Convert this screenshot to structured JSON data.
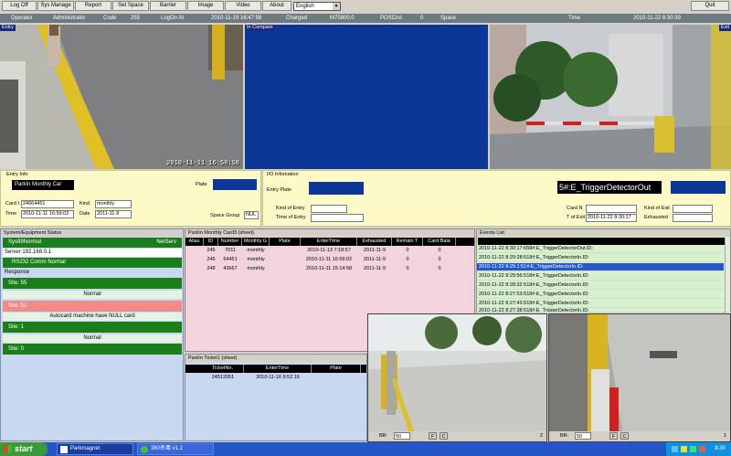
{
  "toolbar": {
    "buttons": [
      "Log Off",
      "Sys Manage",
      "Report",
      "Set Space",
      "Barrier",
      "Image",
      "Video",
      "About"
    ],
    "language": "English",
    "quit": "Quit"
  },
  "status": {
    "operator_label": "Operator",
    "operator_value": "Administrator",
    "code_label": "Code",
    "code_value": "255",
    "logon_label": "LogOn At",
    "logon_value": "2010-11-19 16:47:58",
    "charged_label": "Charged",
    "charged_value": "M70800.0",
    "poscnt_label": "POSCnd",
    "poscnt_value": "0",
    "space_label": "Space",
    "time_label": "Time",
    "time_value": "2010-11-22 8:30:39"
  },
  "cameras": {
    "entry_label": "Entry",
    "entry_timestamp": "2010-11-11 16:58:58",
    "compare_label": "In Compare",
    "exit_label": "Exit",
    "exit_plate": "5#:E_TriggerDetectorOut"
  },
  "entry_info": {
    "title": "Entry Info",
    "card_type": "ParkIn Monthly Car",
    "plate_label": "Plate",
    "card_label": "Card I",
    "card_value": "24664451",
    "kind_label": "Kind",
    "kind_value": "monthly",
    "time_label": "Time",
    "time_value": "2010-11-11 16:59:02",
    "date_label": "Date",
    "date_value": "2011-11-9",
    "space_group_label": "Space Group",
    "space_group_value": "NUL"
  },
  "io_info": {
    "title": "I/O Infomation",
    "entry_plate_label": "Entry Plate",
    "kind_of_entry_label": "Kind of Entry",
    "time_of_entry_label": "Time of Entry",
    "card_no_label": "Card N",
    "time_of_exit_label": "T of Exit",
    "time_of_exit_value": "2010-11-22 8:30:17",
    "kind_of_exit_label": "Kind of Exit",
    "exhausted_label": "Exhausted"
  },
  "system": {
    "title": "System/Equipment Status",
    "sys_label": "Sys99Normal",
    "netserv": "NetServ",
    "server": "Server:192.168.0.1",
    "rs232": "RS232 Comm Normal",
    "response": "Response",
    "site55": "Site:  55",
    "normal1": "Normal",
    "site51": "Site:  51",
    "autocard": "Autocard machine have NULL card",
    "site1": "Site:  1",
    "normal2": "Normal",
    "site0": "Site:  0"
  },
  "monthly": {
    "title": "ParkIn Monthly Card3 (sheet)",
    "columns": [
      "Alias",
      "ID",
      "Number",
      "Monthly G",
      "Plate",
      "EnterTime",
      "Exhausted",
      "Remain T",
      "Card Bala"
    ],
    "rows": [
      [
        "245",
        "7011",
        "monthly",
        "",
        "2010-11-13 7:18:57",
        "2011-11-9",
        "0",
        "0"
      ],
      [
        "246",
        "64451",
        "monthly",
        "",
        "2010-11-11 16:59:02",
        "2011-11-9",
        "0",
        "0"
      ],
      [
        "248",
        "43667",
        "monthly",
        "",
        "2010-11-11 15:14:58",
        "2011-11-9",
        "0",
        "0"
      ]
    ]
  },
  "ticket": {
    "title": "ParkIn Ticket1 (sheet)",
    "columns": [
      "TicketNo.",
      "EnterTime",
      "Plate"
    ],
    "rows": [
      [
        "24512051",
        "2010-11-16 9:52:16",
        ""
      ]
    ]
  },
  "events": {
    "title": "Events List",
    "items": [
      "2010-11-22 8:30:17:658#:E_TriggerDetectorOut.ID:",
      "2010-11-22 8:29:28:518#:E_TriggerDetectorIn.ID:",
      "2010-11-22 8:29:1:51#:E_TriggerDetectorIn.ID:",
      "2010-11-22 8:29:56:518#:E_TriggerDetectorIn.ID:",
      "2010-11-22 8:28:32:518#:E_TriggerDetectorIn.ID:",
      "2010-11-22 8:27:53:518#:E_TriggerDetectorIn.ID:",
      "2010-11-22 8:27:43:518#:E_TriggerDetectorIn.ID:",
      "2010-11-22 8:27:38:518#:E_TriggerDetectorIn.ID:"
    ]
  },
  "small_cams": {
    "left_br": "BR:",
    "left_val": "50",
    "left_f": "F",
    "left_c": "C",
    "left_num": "2",
    "right_br": "BR:",
    "right_val": "50",
    "right_f": "F",
    "right_c": "C",
    "right_num": "1"
  },
  "taskbar": {
    "start": "start",
    "task1": "Parkmagnet",
    "task2": "360杀毒 v1.1",
    "clock": "8:30"
  }
}
